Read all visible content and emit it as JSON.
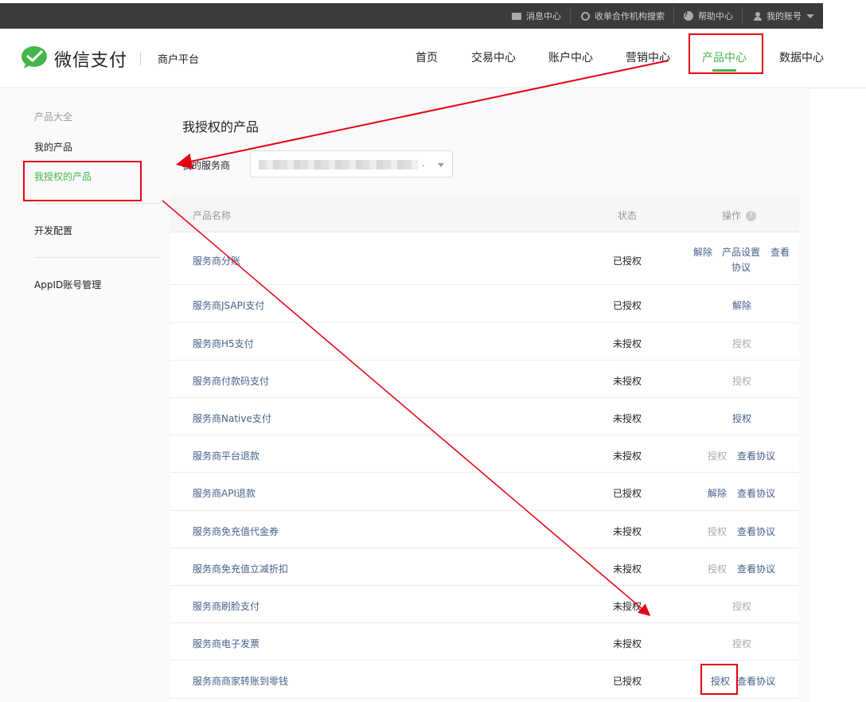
{
  "topbar": {
    "message_center": "消息中心",
    "acquirer_search": "收单合作机构搜索",
    "help_center": "帮助中心",
    "my_account": "我的账号"
  },
  "header": {
    "brand": "微信支付",
    "subtitle": "商户平台",
    "brand_color": "#44b549",
    "nav": [
      "首页",
      "交易中心",
      "账户中心",
      "营销中心",
      "产品中心",
      "数据中心"
    ],
    "active_nav": "产品中心"
  },
  "sidebar": {
    "section_title": "产品大全",
    "items": [
      "我的产品",
      "我授权的产品",
      "开发配置",
      "AppID账号管理"
    ],
    "active_item": "我授权的产品"
  },
  "main": {
    "title": "我授权的产品",
    "filter_label": "我的服务商",
    "filter_value_suffix": ".",
    "columns": [
      "产品名称",
      "状态",
      "操作"
    ],
    "column_help": "?",
    "rows": [
      {
        "name": "服务商分账",
        "status": "已授权",
        "ops": [
          "解除",
          "产品设置",
          "查看",
          "协议"
        ]
      },
      {
        "name": "服务商JSAPI支付",
        "status": "已授权",
        "ops": [
          "解除"
        ]
      },
      {
        "name": "服务商H5支付",
        "status": "未授权",
        "ops": [
          "授权"
        ]
      },
      {
        "name": "服务商付款码支付",
        "status": "未授权",
        "ops": [
          "授权"
        ]
      },
      {
        "name": "服务商Native支付",
        "status": "未授权",
        "ops": [
          "授权"
        ]
      },
      {
        "name": "服务商平台退款",
        "status": "未授权",
        "ops": [
          "授权",
          "查看协议"
        ]
      },
      {
        "name": "服务商API退款",
        "status": "已授权",
        "ops": [
          "解除",
          "查看协议"
        ]
      },
      {
        "name": "服务商免充值代金券",
        "status": "未授权",
        "ops": [
          "授权",
          "查看协议"
        ]
      },
      {
        "name": "服务商免充值立减折扣",
        "status": "未授权",
        "ops": [
          "授权",
          "查看协议"
        ]
      },
      {
        "name": "服务商刷脸支付",
        "status": "未授权",
        "ops": [
          "授权"
        ]
      },
      {
        "name": "服务商电子发票",
        "status": "未授权",
        "ops": [
          "授权"
        ]
      },
      {
        "name": "服务商商家转账到零钱",
        "status": "已授权",
        "ops": [
          "授权",
          "查看协议"
        ]
      }
    ]
  },
  "annotation_color": "#e60012"
}
